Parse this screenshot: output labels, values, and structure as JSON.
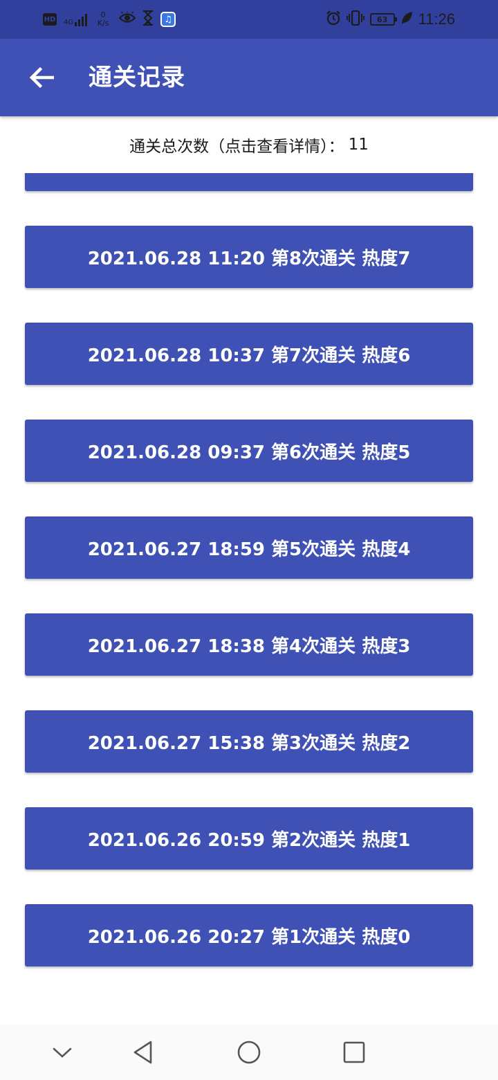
{
  "status_bar": {
    "hd": "HD",
    "network": "4G",
    "speed_value": "0",
    "speed_unit": "K/s",
    "battery": "63",
    "time": "11:26",
    "icons": [
      "hd-icon",
      "signal-icon",
      "eye-icon",
      "hourglass-icon",
      "music-app-icon",
      "alarm-icon",
      "vibrate-icon",
      "battery-icon",
      "leaf-icon"
    ]
  },
  "app_bar": {
    "title": "通关记录"
  },
  "summary": {
    "label": "通关总次数（点击查看详情）：",
    "count": "11"
  },
  "records": [
    "2021.06.28 11:20 第8次通关 热度7",
    "2021.06.28 10:37 第7次通关 热度6",
    "2021.06.28 09:37 第6次通关 热度5",
    "2021.06.27 18:59 第5次通关 热度4",
    "2021.06.27 18:38 第4次通关 热度3",
    "2021.06.27 15:38 第3次通关 热度2",
    "2021.06.26 20:59 第2次通关 热度1",
    "2021.06.26 20:27 第1次通关 热度0"
  ],
  "colors": {
    "primary": "#3f51b5",
    "primary_dark": "#31409d",
    "button_text": "#ffffff"
  }
}
